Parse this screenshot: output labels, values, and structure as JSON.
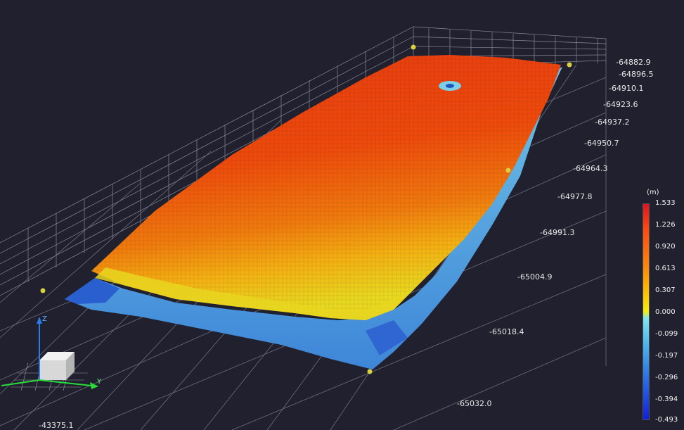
{
  "axis_ticks_y": [
    "-64882.9",
    "-64896.5",
    "-64910.1",
    "-64923.6",
    "-64937.2",
    "-64950.7",
    "-64964.3",
    "-64977.8",
    "-64991.3",
    "-65004.9",
    "-65018.4",
    "-65032.0"
  ],
  "axis_tick_x": "-43375.1",
  "colorbar": {
    "unit": "(m)",
    "labels": [
      "1.533",
      "1.226",
      "0.920",
      "0.613",
      "0.307",
      "0.000",
      "-0.099",
      "-0.197",
      "-0.296",
      "-0.394",
      "-0.493"
    ]
  },
  "gizmo": {
    "z_label": "Z",
    "y_label": "Y"
  },
  "colors": {
    "background": "#20202f",
    "grid": "#6e6e7a",
    "high": "#e0141e",
    "low": "#1020e0",
    "handle": "#d8d040"
  }
}
